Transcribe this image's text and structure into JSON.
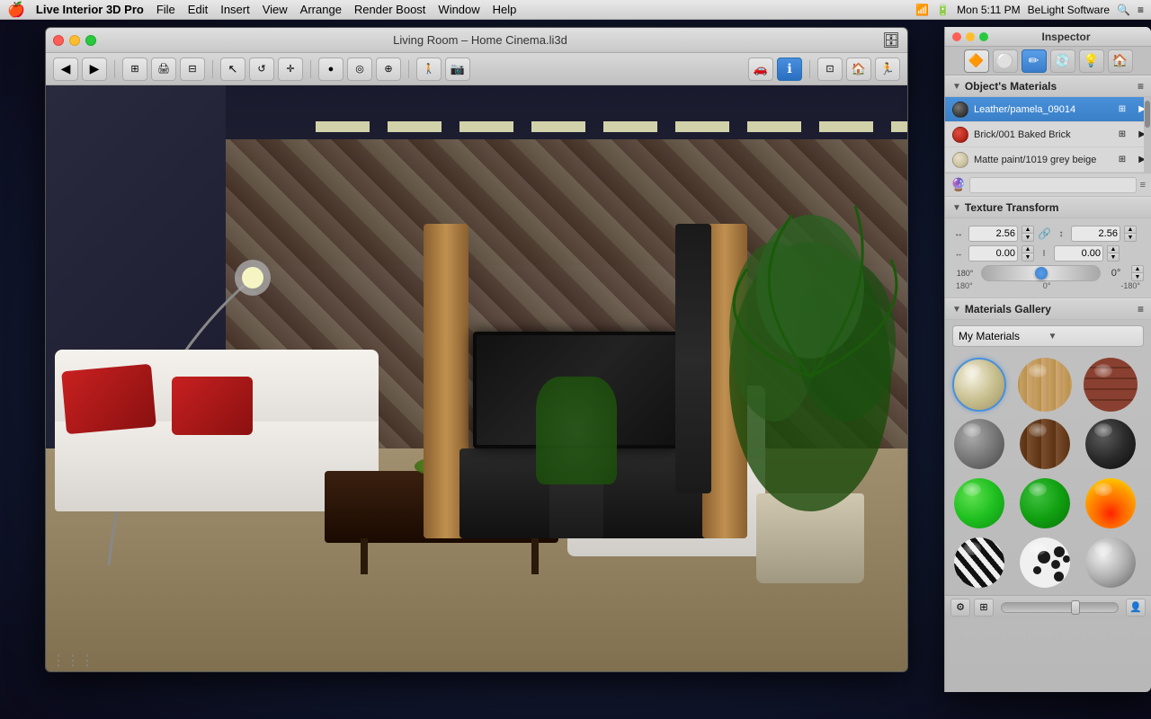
{
  "app": {
    "name": "Live Interior 3D Pro",
    "menu_items": [
      "File",
      "Edit",
      "Insert",
      "View",
      "Arrange",
      "Render Boost",
      "Window",
      "Help"
    ],
    "status_right": "Mon 5:11 PM",
    "company": "BeLight Software"
  },
  "main_window": {
    "title": "Living Room – Home Cinema.li3d",
    "traffic_lights": {
      "red": "close",
      "yellow": "minimize",
      "green": "maximize"
    }
  },
  "toolbar": {
    "nav_back": "←",
    "nav_forward": "→",
    "tools": [
      "floor-plan",
      "render",
      "2d-view",
      "select",
      "rotate",
      "move",
      "orbit",
      "camera",
      "render-boost",
      "info",
      "frame",
      "house",
      "walk"
    ]
  },
  "inspector": {
    "title": "Inspector",
    "tabs": [
      {
        "name": "materials-tab",
        "icon": "🔷",
        "active": true
      },
      {
        "name": "sphere-tab",
        "icon": "⚪"
      },
      {
        "name": "pencil-tab",
        "icon": "✏️"
      },
      {
        "name": "coin-tab",
        "icon": "💿"
      },
      {
        "name": "bulb-tab",
        "icon": "💡"
      },
      {
        "name": "house-tab",
        "icon": "🏠"
      }
    ],
    "objects_materials": {
      "label": "Object's Materials",
      "items": [
        {
          "name": "Leather/pamela_09014",
          "swatch_color": "#555555",
          "selected": true
        },
        {
          "name": "Brick/001 Baked Brick",
          "swatch_color": "#cc3322",
          "selected": false
        },
        {
          "name": "Matte paint/1019 grey beige",
          "swatch_color": "#d4c8a8",
          "selected": false
        }
      ]
    },
    "texture_transform": {
      "label": "Texture Transform",
      "width_value": "2.56",
      "height_value": "2.56",
      "offset_x": "0.00",
      "offset_y": "0.00",
      "angle_value": "0°",
      "angle_min": "180°",
      "angle_center": "0°",
      "angle_max": "-180°"
    },
    "materials_gallery": {
      "label": "Materials Gallery",
      "dropdown": "My Materials",
      "items": [
        {
          "name": "cream",
          "style": "cream",
          "selected": true
        },
        {
          "name": "wood-light",
          "style": "wood_light"
        },
        {
          "name": "brick-red",
          "style": "brick"
        },
        {
          "name": "stone-grey",
          "style": "stone"
        },
        {
          "name": "wood-dark",
          "style": "wood_dark"
        },
        {
          "name": "dark-black",
          "style": "dark"
        },
        {
          "name": "green-bright",
          "style": "green_bright"
        },
        {
          "name": "green-dark",
          "style": "green_dark"
        },
        {
          "name": "fire",
          "style": "fire"
        },
        {
          "name": "zebra",
          "style": "zebra"
        },
        {
          "name": "spots",
          "style": "spots"
        },
        {
          "name": "silver",
          "style": "silver"
        }
      ]
    }
  }
}
